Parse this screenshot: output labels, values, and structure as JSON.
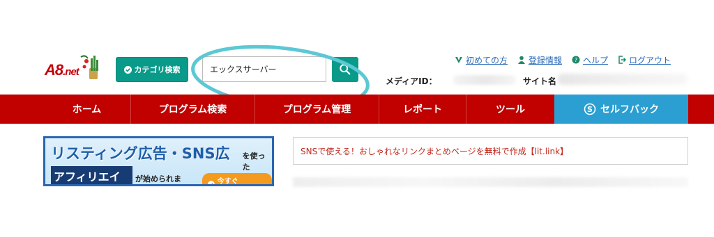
{
  "logo": {
    "text": "A8",
    "suffix": ".net"
  },
  "header": {
    "category_button": "カテゴリ検索",
    "search_value": "エックスサーバー",
    "links": [
      {
        "label": "初めての方",
        "icon": "leaf-icon"
      },
      {
        "label": "登録情報",
        "icon": "user-icon"
      },
      {
        "label": "ヘルプ",
        "icon": "help-icon"
      },
      {
        "label": "ログアウト",
        "icon": "logout-icon"
      }
    ],
    "media_id_label": "メディアID：",
    "site_label": "サイト名"
  },
  "nav": {
    "items": [
      "ホーム",
      "プログラム検索",
      "プログラム管理",
      "レポート",
      "ツール"
    ],
    "selfback": "セルフバック"
  },
  "banner": {
    "line1": "リスティング広告・SNS広告",
    "line1_small": "を使った",
    "line2": "アフィリエイト",
    "line2_small": "が始められます！",
    "cta": "今すぐCHECK!"
  },
  "notice": {
    "text": "SNSで使える！おしゃれなリンクまとめページを無料で作成【lit.link】"
  },
  "colors": {
    "nav_red": "#c10000",
    "teal": "#0a9a8a",
    "selfback_blue": "#2b9fd2",
    "oval": "#5bc8d4"
  }
}
